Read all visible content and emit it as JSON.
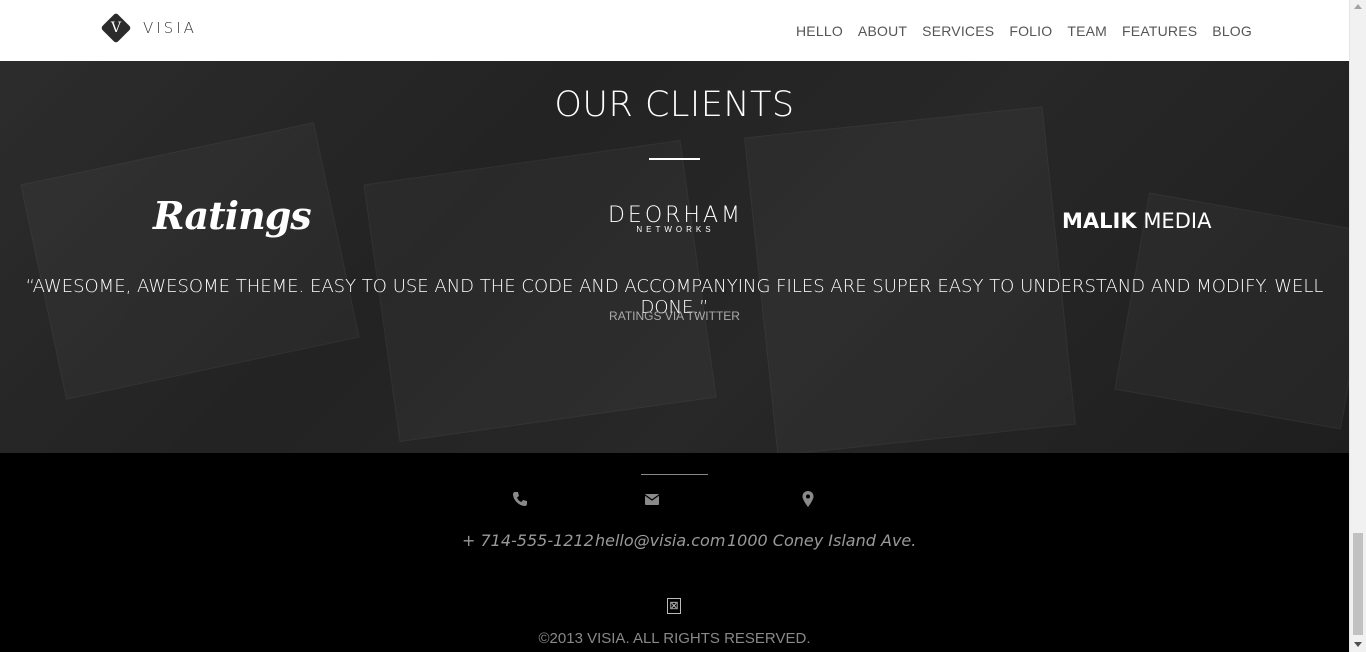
{
  "brand": {
    "mark_letter": "V",
    "name": "VISIA"
  },
  "nav": {
    "items": [
      {
        "label": "HELLO"
      },
      {
        "label": "ABOUT"
      },
      {
        "label": "SERVICES"
      },
      {
        "label": "FOLIO"
      },
      {
        "label": "TEAM"
      },
      {
        "label": "FEATURES"
      },
      {
        "label": "BLOG"
      }
    ]
  },
  "clients": {
    "title": "OUR CLIENTS",
    "logos": {
      "ratings": "Ratings",
      "deorham_main": "DEORHAM",
      "deorham_sub": "NETWORKS",
      "malik_bold": "MALIK",
      "malik_light": "MEDIA"
    },
    "quote": "“AWESOME, AWESOME THEME. EASY TO USE AND THE CODE AND ACCOMPANYING FILES ARE SUPER EASY TO UNDERSTAND AND MODIFY. WELL DONE.”",
    "quote_source": "RATINGS VIA TWITTER"
  },
  "footer": {
    "phone": {
      "icon": "phone-icon",
      "text": "+ 714-555-1212"
    },
    "email": {
      "icon": "envelope-icon",
      "text": "hello@visia.com"
    },
    "address": {
      "icon": "map-marker-icon",
      "text": "1000 Coney Island Ave."
    },
    "social_icon": "missing-glyph",
    "copyright": "©2013 VISIA. ALL RIGHTS RESERVED."
  },
  "colors": {
    "header_bg": "#ffffff",
    "footer_bg": "#000000",
    "nav_text": "#555555"
  }
}
